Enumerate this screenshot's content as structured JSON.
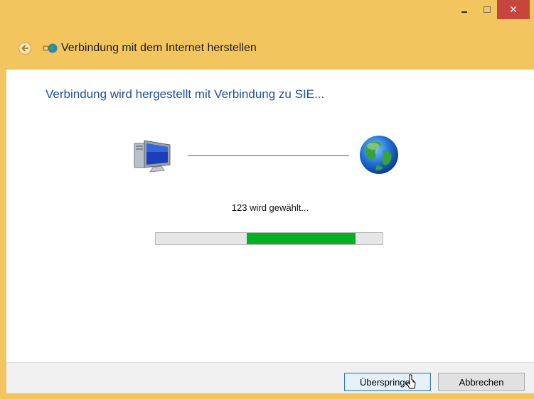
{
  "window": {
    "title": "Verbindung mit dem Internet herstellen",
    "frame_color": "#f3c55f",
    "close_color": "#c7463b"
  },
  "caption_buttons": {
    "minimize_icon": "minimize-icon",
    "maximize_icon": "maximize-icon",
    "close_glyph": "✕"
  },
  "nav": {
    "back_icon": "back-arrow-icon",
    "title_icon": "network-connection-icon"
  },
  "main": {
    "heading": "Verbindung wird hergestellt mit Verbindung zu SIE...",
    "heading_color": "#1d4fa3",
    "left_icon": "computer-icon",
    "right_icon": "globe-icon",
    "status_text": "123 wird gewählt...",
    "progress": {
      "style": "marquee",
      "chunk_start": 0.4,
      "chunk_end": 0.88,
      "color": "#06b025"
    }
  },
  "footer": {
    "skip_label": "Überspringen",
    "cancel_label": "Abbrechen"
  }
}
